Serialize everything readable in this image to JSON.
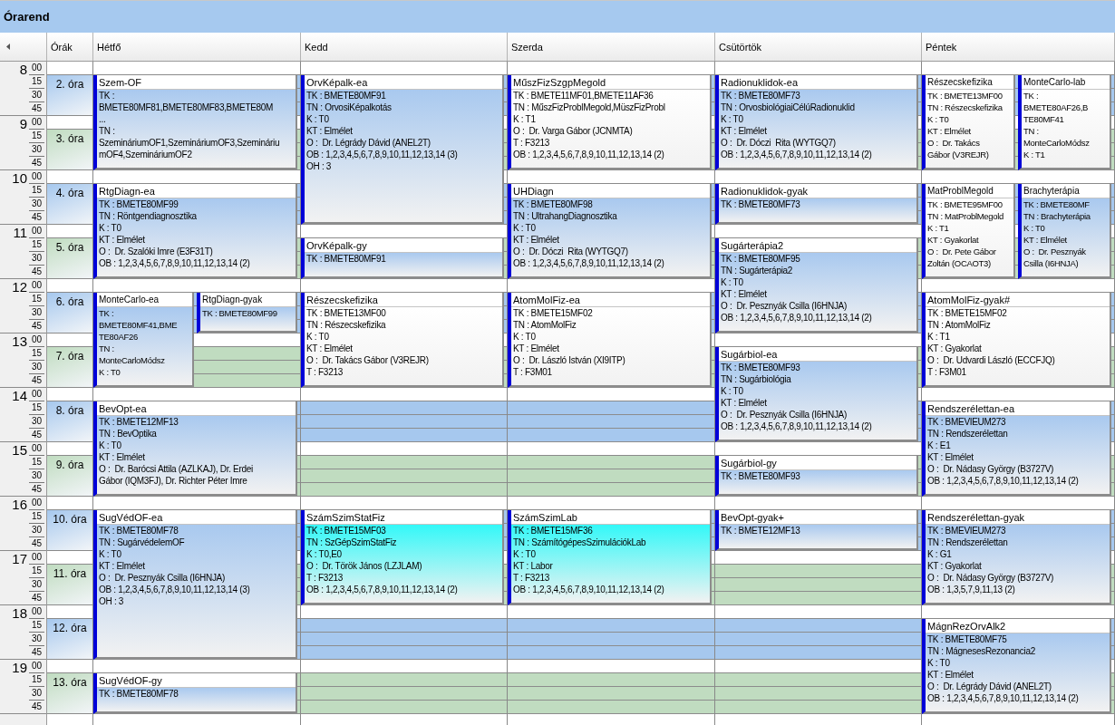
{
  "title": "Órarend",
  "hours_header": "Órák",
  "hours": [
    {
      "hour": "8",
      "minutes": [
        "00",
        "15",
        "30",
        "45"
      ]
    },
    {
      "hour": "9",
      "minutes": [
        "00",
        "15",
        "30",
        "45"
      ]
    },
    {
      "hour": "10",
      "minutes": [
        "00",
        "15",
        "30",
        "45"
      ]
    },
    {
      "hour": "11",
      "minutes": [
        "00",
        "15",
        "30",
        "45"
      ]
    },
    {
      "hour": "12",
      "minutes": [
        "00",
        "15",
        "30",
        "45"
      ]
    },
    {
      "hour": "13",
      "minutes": [
        "00",
        "15",
        "30",
        "45"
      ]
    },
    {
      "hour": "14",
      "minutes": [
        "00",
        "15",
        "30",
        "45"
      ]
    },
    {
      "hour": "15",
      "minutes": [
        "00",
        "15",
        "30",
        "45"
      ]
    },
    {
      "hour": "16",
      "minutes": [
        "00",
        "15",
        "30",
        "45"
      ]
    },
    {
      "hour": "17",
      "minutes": [
        "00",
        "15",
        "30",
        "45"
      ]
    },
    {
      "hour": "18",
      "minutes": [
        "00",
        "15",
        "30",
        "45"
      ]
    },
    {
      "hour": "19",
      "minutes": [
        "00",
        "15",
        "30",
        "45"
      ]
    }
  ],
  "periods": [
    "2. óra",
    "3. óra",
    "4. óra",
    "5. óra",
    "6. óra",
    "7. óra",
    "8. óra",
    "9. óra",
    "10. óra",
    "11. óra",
    "12. óra",
    "13. óra"
  ],
  "days": [
    {
      "name": "Hétfő",
      "blocks": [
        {
          "kind": "lessons",
          "lessons": [
            {
              "title": "Szem-OF",
              "kind": "double",
              "color": "#a9c9ef",
              "lines": [
                "TK :",
                "BMETE80MF81,BMETE80MF83,BMETE80M",
                "...",
                "TN :",
                "SzemináriumOF1,SzemináriumOF3,Szemináriu",
                "mOF4,SzemináriumOF2"
              ]
            }
          ]
        },
        {
          "kind": "lessons",
          "lessons": [
            {
              "title": "RtgDiagn-ea",
              "kind": "double",
              "color": "#a9c9ef",
              "lines": [
                "TK : BMETE80MF99",
                "TN : Röntgendiagnosztika",
                "K : T0",
                "KT : Elmélet",
                "O :  Dr. Szalóki Imre (E3F31T)",
                "OB : 1,2,3,4,5,6,7,8,9,10,11,12,13,14 (2)"
              ]
            }
          ]
        },
        {
          "kind": "lessons",
          "lessons": [
            {
              "title": "MonteCarlo-ea",
              "kind": "double",
              "color": "#a9c9ef",
              "lines": [
                "TK :",
                "BMETE80MF41,BME",
                "TE80AF26",
                "TN :",
                "MonteCarloMódsz",
                "K : T0"
              ]
            },
            {
              "title": "RtgDiagn-gyak",
              "kind": "single",
              "color": "#a9c9ef",
              "lines": [
                "TK : BMETE80MF99"
              ]
            }
          ]
        },
        {
          "kind": "lessons",
          "lessons": [
            {
              "title": "BevOpt-ea",
              "kind": "double",
              "color": "#a9c9ef",
              "lines": [
                "TK : BMETE12MF13",
                "TN : BevOptika",
                "K : T0",
                "KT : Elmélet",
                "O :  Dr. Barócsi Attila (AZLKAJ), Dr. Erdei",
                "Gábor (IQM3FJ), Dr. Richter Péter Imre"
              ]
            }
          ]
        },
        {
          "kind": "lessons",
          "lessons": [
            {
              "title": "SugVédOF-ea",
              "kind": "triple",
              "color": "#a9c9ef",
              "lines": [
                "TK : BMETE80MF78",
                "TN : SugárvédelemOF",
                "K : T0",
                "KT : Elmélet",
                "O :  Dr. Pesznyák Csilla (I6HNJA)",
                "OB : 1,2,3,4,5,6,7,8,9,10,11,12,13,14 (3)",
                "OH : 3"
              ]
            }
          ]
        },
        {
          "kind": "lessons",
          "lessons": [
            {
              "title": "SugVédOF-gy",
              "kind": "single",
              "color": "#a9c9ef",
              "lines": [
                "TK : BMETE80MF78"
              ]
            }
          ]
        }
      ]
    },
    {
      "name": "Kedd",
      "blocks": [
        {
          "kind": "lessons",
          "lessons": [
            {
              "title": "OrvKépalk-ea",
              "kind": "triple",
              "color": "#a9c9ef",
              "lines": [
                "TK : BMETE80MF91",
                "TN : OrvosiKépalkotás",
                "K : T0",
                "KT : Elmélet",
                "O :  Dr. Légrády Dávid (ANEL2T)",
                "OB : 1,2,3,4,5,6,7,8,9,10,11,12,13,14 (3)",
                "OH : 3"
              ]
            }
          ]
        },
        {
          "kind": "lessons",
          "lessons": [
            {
              "title": "OrvKépalk-gy",
              "kind": "single",
              "color": "#a9c9ef",
              "lines": [
                "TK : BMETE80MF91"
              ]
            }
          ]
        },
        {
          "kind": "lessons",
          "lessons": [
            {
              "title": "Részecskefizika",
              "kind": "double",
              "color": "#ffffff",
              "lines": [
                "TK : BMETE13MF00",
                "TN : Részecskefizika",
                "K : T0",
                "KT : Elmélet",
                "O :  Dr. Takács Gábor (V3REJR)",
                "T : F3213"
              ]
            }
          ]
        },
        {
          "kind": "free"
        },
        {
          "kind": "free"
        },
        {
          "kind": "lessons",
          "lessons": [
            {
              "title": "SzámSzimStatFiz",
              "kind": "double",
              "color": "#33f8f8",
              "lines": [
                "TK : BMETE15MF03",
                "TN : SzGépSzimStatFiz",
                "K : T0,E0",
                "O :  Dr. Török János (LZJLAM)",
                "T : F3213",
                "OB : 1,2,3,4,5,6,7,8,9,10,11,12,13,14 (2)"
              ]
            }
          ]
        },
        {
          "kind": "free"
        },
        {
          "kind": "free"
        }
      ]
    },
    {
      "name": "Szerda",
      "blocks": [
        {
          "kind": "lessons",
          "lessons": [
            {
              "title": "MűszFizSzgpMegold",
              "kind": "double",
              "color": "#ffffff",
              "lines": [
                "TK : BMETE11MF01,BMETE11AF36",
                "TN : MűszFizProblMegold,MüszFizProbl",
                "K : T1",
                "O :  Dr. Varga Gábor (JCNMTA)",
                "T : F3213",
                "OB : 1,2,3,4,5,6,7,8,9,10,11,12,13,14 (2)"
              ]
            }
          ]
        },
        {
          "kind": "lessons",
          "lessons": [
            {
              "title": "UHDiagn",
              "kind": "double",
              "color": "#a9c9ef",
              "lines": [
                "TK : BMETE80MF98",
                "TN : UltrahangDiagnosztika",
                "K : T0",
                "KT : Elmélet",
                "O :  Dr. Dóczi  Rita (WYTGQ7)",
                "OB : 1,2,3,4,5,6,7,8,9,10,11,12,13,14 (2)"
              ]
            }
          ]
        },
        {
          "kind": "lessons",
          "lessons": [
            {
              "title": "AtomMolFiz-ea",
              "kind": "double",
              "color": "#ffffff",
              "lines": [
                "TK : BMETE15MF02",
                "TN : AtomMolFiz",
                "K : T0",
                "KT : Elmélet",
                "O :  Dr. László István (XI9ITP)",
                "T : F3M01"
              ]
            }
          ]
        },
        {
          "kind": "free"
        },
        {
          "kind": "free"
        },
        {
          "kind": "lessons",
          "lessons": [
            {
              "title": "SzámSzimLab",
              "kind": "double",
              "color": "#33f8f8",
              "lines": [
                "TK : BMETE15MF36",
                "TN : SzámítógépesSzimulációkLab",
                "K : T0",
                "KT : Labor",
                "T : F3213",
                "OB : 1,2,3,4,5,6,7,8,9,10,11,12,13,14 (2)"
              ]
            }
          ]
        },
        {
          "kind": "free"
        },
        {
          "kind": "free"
        }
      ]
    },
    {
      "name": "Csütörtök",
      "blocks": [
        {
          "kind": "lessons",
          "lessons": [
            {
              "title": "Radionuklidok-ea",
              "kind": "double",
              "color": "#a9c9ef",
              "lines": [
                "TK : BMETE80MF73",
                "TN : OrvosbiológiaiCélúRadionuklid",
                "K : T0",
                "KT : Elmélet",
                "O :  Dr. Dóczi  Rita (WYTGQ7)",
                "OB : 1,2,3,4,5,6,7,8,9,10,11,12,13,14 (2)"
              ]
            }
          ]
        },
        {
          "kind": "lessons",
          "lessons": [
            {
              "title": "Radionuklidok-gyak",
              "kind": "single",
              "color": "#a9c9ef",
              "lines": [
                "TK : BMETE80MF73"
              ]
            }
          ]
        },
        {
          "kind": "lessons",
          "lessons": [
            {
              "title": "Sugárterápia2",
              "kind": "double",
              "color": "#a9c9ef",
              "lines": [
                "TK : BMETE80MF95",
                "TN : Sugárterápia2",
                "K : T0",
                "KT : Elmélet",
                "O :  Dr. Pesznyák Csilla (I6HNJA)",
                "OB : 1,2,3,4,5,6,7,8,9,10,11,12,13,14 (2)"
              ]
            }
          ]
        },
        {
          "kind": "lessons",
          "lessons": [
            {
              "title": "Sugárbiol-ea",
              "kind": "double",
              "color": "#a9c9ef",
              "lines": [
                "TK : BMETE80MF93",
                "TN : Sugárbiológia",
                "K : T0",
                "KT : Elmélet",
                "O :  Dr. Pesznyák Csilla (I6HNJA)",
                "OB : 1,2,3,4,5,6,7,8,9,10,11,12,13,14 (2)"
              ]
            }
          ]
        },
        {
          "kind": "lessons",
          "lessons": [
            {
              "title": "Sugárbiol-gy",
              "kind": "single",
              "color": "#a9c9ef",
              "lines": [
                "TK : BMETE80MF93"
              ]
            }
          ]
        },
        {
          "kind": "lessons",
          "lessons": [
            {
              "title": "BevOpt-gyak+",
              "kind": "single",
              "color": "#a9c9ef",
              "lines": [
                "TK : BMETE12MF13"
              ]
            }
          ]
        },
        {
          "kind": "free"
        },
        {
          "kind": "free"
        },
        {
          "kind": "free"
        }
      ]
    },
    {
      "name": "Péntek",
      "blocks": [
        {
          "kind": "lessons",
          "lessons": [
            {
              "title": "Részecskefizika",
              "kind": "double",
              "color": "#ffffff",
              "lines": [
                "TK : BMETE13MF00",
                "TN : Részecskefizika",
                "K : T0",
                "KT : Elmélet",
                "O :  Dr. Takács",
                "Gábor (V3REJR)"
              ]
            },
            {
              "title": "MonteCarlo-lab",
              "kind": "double",
              "color": "#ffffff",
              "lines": [
                "TK :",
                "BMETE80AF26,B",
                "TE80MF41",
                "TN :",
                "MonteCarloMódsz",
                "K : T1"
              ]
            }
          ]
        },
        {
          "kind": "lessons",
          "lessons": [
            {
              "title": "MatProblMegold",
              "kind": "double",
              "color": "#ffffff",
              "lines": [
                "TK : BMETE95MF00",
                "TN : MatProblMegold",
                "K : T1",
                "KT : Gyakorlat",
                "O :  Dr. Pete Gábor",
                "Zoltán (OCAOT3)"
              ]
            },
            {
              "title": "Brachyterápia",
              "kind": "double",
              "color": "#a9c9ef",
              "lines": [
                "TK : BMETE80MF",
                "TN : Brachyterápia",
                "K : T0",
                "KT : Elmélet",
                "O :  Dr. Pesznyák",
                "Csilla (I6HNJA)"
              ]
            }
          ]
        },
        {
          "kind": "lessons",
          "lessons": [
            {
              "title": "AtomMolFiz-gyak#",
              "kind": "double",
              "color": "#ffffff",
              "lines": [
                "TK : BMETE15MF02",
                "TN : AtomMolFiz",
                "K : T1",
                "KT : Gyakorlat",
                "O :  Dr. Udvardi László (ECCFJQ)",
                "T : F3M01"
              ]
            }
          ]
        },
        {
          "kind": "lessons",
          "lessons": [
            {
              "title": "Rendszerélettan-ea",
              "kind": "double",
              "color": "#a9c9ef",
              "lines": [
                "TK : BMEVIEUM273",
                "TN : Rendszerélettan",
                "K : E1",
                "KT : Elmélet",
                "O :  Dr. Nádasy György (B3727V)",
                "OB : 1,2,3,4,5,6,7,8,9,10,11,12,13,14 (2)"
              ]
            }
          ]
        },
        {
          "kind": "lessons",
          "lessons": [
            {
              "title": "Rendszerélettan-gyak",
              "kind": "double",
              "color": "#a9c9ef",
              "lines": [
                "TK : BMEVIEUM273",
                "TN : Rendszerélettan",
                "K : G1",
                "KT : Gyakorlat",
                "O :  Dr. Nádasy György (B3727V)",
                "OB : 1,3,5,7,9,11,13 (2)"
              ]
            }
          ]
        },
        {
          "kind": "lessons",
          "lessons": [
            {
              "title": "MágnRezOrvAlk2",
              "kind": "double",
              "color": "#a9c9ef",
              "lines": [
                "TK : BMETE80MF75",
                "TN : MágnesesRezonancia2",
                "K : T0",
                "KT : Elmélet",
                "O :  Dr. Légrády Dávid (ANEL2T)",
                "OB : 1,2,3,4,5,6,7,8,9,10,11,12,13,14 (2)"
              ]
            }
          ]
        }
      ]
    }
  ]
}
